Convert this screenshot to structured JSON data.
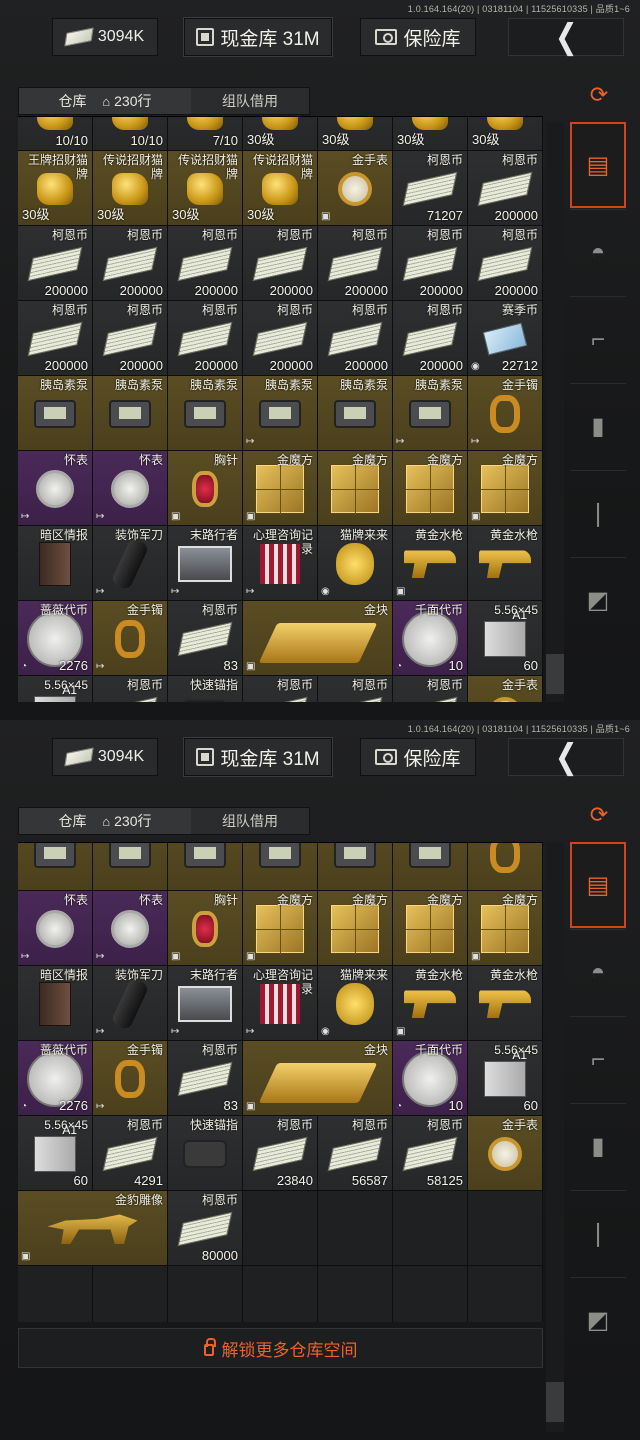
{
  "build": "1.0.164.164(20) | 03181104 | 11525610335 | 品质1~6",
  "topbar": {
    "cash": "3094K",
    "vault": "现金库 31M",
    "safe": "保险库"
  },
  "tabs": {
    "warehouse": "仓库",
    "rows": "230行",
    "team": "组队借用"
  },
  "unlock_label": "解锁更多仓库空间",
  "side_icons": [
    "refresh-icon",
    "warehouse-icon",
    "helmet-icon",
    "rifle-icon",
    "magazine-icon",
    "bullet-icon",
    "scope-icon"
  ],
  "panel1_rows": [
    [
      {
        "r": "gray",
        "ico": "i-tag",
        "c": "10/10"
      },
      {
        "r": "gray",
        "ico": "i-tag",
        "c": "10/10"
      },
      {
        "r": "gray",
        "ico": "i-tag",
        "c": "7/10"
      },
      {
        "r": "gray",
        "ico": "i-tag",
        "l": "30级"
      },
      {
        "r": "gray",
        "ico": "i-tag",
        "l": "30级"
      },
      {
        "r": "gray",
        "ico": "i-tag",
        "l": "30级"
      },
      {
        "r": "gray",
        "ico": "i-tag",
        "l": "30级"
      }
    ],
    [
      {
        "r": "gold",
        "n": "王牌招财猫牌",
        "ico": "i-tag",
        "l": "30级"
      },
      {
        "r": "gold",
        "n": "传说招财猫牌",
        "ico": "i-tag",
        "l": "30级"
      },
      {
        "r": "gold",
        "n": "传说招财猫牌",
        "ico": "i-tag",
        "l": "30级"
      },
      {
        "r": "gold",
        "n": "传说招财猫牌",
        "ico": "i-tag",
        "l": "30级"
      },
      {
        "r": "gold",
        "n": "金手表",
        "ico": "i-watch",
        "b": "box"
      },
      {
        "r": "gray",
        "n": "柯恩币",
        "ico": "i-cash",
        "c": "71207"
      },
      {
        "r": "gray",
        "n": "柯恩币",
        "ico": "i-cash",
        "c": "200000"
      }
    ],
    [
      {
        "r": "gray",
        "n": "柯恩币",
        "ico": "i-cash",
        "c": "200000"
      },
      {
        "r": "gray",
        "n": "柯恩币",
        "ico": "i-cash",
        "c": "200000"
      },
      {
        "r": "gray",
        "n": "柯恩币",
        "ico": "i-cash",
        "c": "200000"
      },
      {
        "r": "gray",
        "n": "柯恩币",
        "ico": "i-cash",
        "c": "200000"
      },
      {
        "r": "gray",
        "n": "柯恩币",
        "ico": "i-cash",
        "c": "200000"
      },
      {
        "r": "gray",
        "n": "柯恩币",
        "ico": "i-cash",
        "c": "200000"
      },
      {
        "r": "gray",
        "n": "柯恩币",
        "ico": "i-cash",
        "c": "200000"
      }
    ],
    [
      {
        "r": "gray",
        "n": "柯恩币",
        "ico": "i-cash",
        "c": "200000"
      },
      {
        "r": "gray",
        "n": "柯恩币",
        "ico": "i-cash",
        "c": "200000"
      },
      {
        "r": "gray",
        "n": "柯恩币",
        "ico": "i-cash",
        "c": "200000"
      },
      {
        "r": "gray",
        "n": "柯恩币",
        "ico": "i-cash",
        "c": "200000"
      },
      {
        "r": "gray",
        "n": "柯恩币",
        "ico": "i-cash",
        "c": "200000"
      },
      {
        "r": "gray",
        "n": "柯恩币",
        "ico": "i-cash",
        "c": "200000"
      },
      {
        "r": "gray",
        "n": "赛季币",
        "ico": "i-card",
        "c": "22712",
        "b": "season"
      }
    ],
    [
      {
        "r": "gold",
        "n": "胰岛素泵",
        "ico": "i-pager"
      },
      {
        "r": "gold",
        "n": "胰岛素泵",
        "ico": "i-pager"
      },
      {
        "r": "gold",
        "n": "胰岛素泵",
        "ico": "i-pager"
      },
      {
        "r": "gold",
        "n": "胰岛素泵",
        "ico": "i-pager",
        "b": "out"
      },
      {
        "r": "gold",
        "n": "胰岛素泵",
        "ico": "i-pager"
      },
      {
        "r": "gold",
        "n": "胰岛素泵",
        "ico": "i-pager",
        "b": "out"
      },
      {
        "r": "gold",
        "n": "金手镯",
        "ico": "i-ring",
        "b": "out"
      }
    ],
    [
      {
        "r": "purple",
        "n": "怀表",
        "ico": "i-pocket",
        "b": "out"
      },
      {
        "r": "purple",
        "n": "怀表",
        "ico": "i-pocket",
        "b": "out"
      },
      {
        "r": "gold",
        "n": "胸针",
        "ico": "i-brooch",
        "b": "box"
      },
      {
        "r": "gold",
        "n": "金魔方",
        "ico": "i-cube",
        "b": "box"
      },
      {
        "r": "gold",
        "n": "金魔方",
        "ico": "i-cube"
      },
      {
        "r": "gold",
        "n": "金魔方",
        "ico": "i-cube"
      },
      {
        "r": "gold",
        "n": "金魔方",
        "ico": "i-cube",
        "b": "box"
      }
    ],
    [
      {
        "r": "gray",
        "n": "暗区情报",
        "ico": "i-book"
      },
      {
        "r": "gray",
        "n": "装饰军刀",
        "ico": "i-knife",
        "b": "out"
      },
      {
        "r": "gray",
        "n": "末路行者",
        "ico": "i-photo",
        "b": "out"
      },
      {
        "r": "gray",
        "n": "心理咨询记录",
        "ico": "i-pack",
        "b": "out"
      },
      {
        "r": "gray",
        "n": "猫牌来来",
        "ico": "i-lucky",
        "b": "season"
      },
      {
        "r": "gray",
        "n": "黄金水枪",
        "ico": "i-pistol",
        "b": "box"
      },
      {
        "r": "gray",
        "n": "黄金水枪",
        "ico": "i-pistol"
      }
    ],
    [
      {
        "r": "purple",
        "n": "蔷薇代币",
        "ico": "i-coin",
        "c": "2276",
        "b": "clock"
      },
      {
        "r": "gold",
        "n": "金手镯",
        "ico": "i-ring",
        "b": "out"
      },
      {
        "r": "gray",
        "n": "柯恩币",
        "ico": "i-cash",
        "c": "83"
      },
      {
        "r": "gold",
        "n": "金块",
        "ico": "i-bars",
        "span": 2,
        "b": "box"
      },
      {
        "r": "purple",
        "n": "千面代币",
        "ico": "i-coin",
        "c": "10",
        "b": "clock"
      },
      {
        "r": "gray",
        "n": "5.56×45",
        "ico": "i-ammo",
        "c": "60"
      }
    ],
    [
      {
        "r": "gray",
        "n": "5.56×45",
        "ico": "i-ammo"
      },
      {
        "r": "gray",
        "n": "柯恩币",
        "ico": "i-cash"
      },
      {
        "r": "gray",
        "n": "快速锚指",
        "ico": "i-scope"
      },
      {
        "r": "gray",
        "n": "柯恩币",
        "ico": "i-cash"
      },
      {
        "r": "gray",
        "n": "柯恩币",
        "ico": "i-cash"
      },
      {
        "r": "gray",
        "n": "柯恩币",
        "ico": "i-cash"
      },
      {
        "r": "gold",
        "n": "金手表",
        "ico": "i-watch"
      }
    ]
  ],
  "panel2_rows": [
    [
      {
        "r": "gold",
        "ico": "i-pager"
      },
      {
        "r": "gold",
        "ico": "i-pager"
      },
      {
        "r": "gold",
        "ico": "i-pager"
      },
      {
        "r": "gold",
        "ico": "i-pager"
      },
      {
        "r": "gold",
        "ico": "i-pager"
      },
      {
        "r": "gold",
        "ico": "i-pager"
      },
      {
        "r": "gold",
        "ico": "i-ring"
      }
    ],
    [
      {
        "r": "purple",
        "n": "怀表",
        "ico": "i-pocket",
        "b": "out"
      },
      {
        "r": "purple",
        "n": "怀表",
        "ico": "i-pocket",
        "b": "out"
      },
      {
        "r": "gold",
        "n": "胸针",
        "ico": "i-brooch",
        "b": "box"
      },
      {
        "r": "gold",
        "n": "金魔方",
        "ico": "i-cube",
        "b": "box"
      },
      {
        "r": "gold",
        "n": "金魔方",
        "ico": "i-cube"
      },
      {
        "r": "gold",
        "n": "金魔方",
        "ico": "i-cube"
      },
      {
        "r": "gold",
        "n": "金魔方",
        "ico": "i-cube",
        "b": "box"
      }
    ],
    [
      {
        "r": "gray",
        "n": "暗区情报",
        "ico": "i-book"
      },
      {
        "r": "gray",
        "n": "装饰军刀",
        "ico": "i-knife",
        "b": "out"
      },
      {
        "r": "gray",
        "n": "末路行者",
        "ico": "i-photo",
        "b": "out"
      },
      {
        "r": "gray",
        "n": "心理咨询记录",
        "ico": "i-pack",
        "b": "out"
      },
      {
        "r": "gray",
        "n": "猫牌来来",
        "ico": "i-lucky",
        "b": "season"
      },
      {
        "r": "gray",
        "n": "黄金水枪",
        "ico": "i-pistol",
        "b": "box"
      },
      {
        "r": "gray",
        "n": "黄金水枪",
        "ico": "i-pistol"
      }
    ],
    [
      {
        "r": "purple",
        "n": "蔷薇代币",
        "ico": "i-coin",
        "c": "2276",
        "b": "clock"
      },
      {
        "r": "gold",
        "n": "金手镯",
        "ico": "i-ring",
        "b": "out"
      },
      {
        "r": "gray",
        "n": "柯恩币",
        "ico": "i-cash",
        "c": "83"
      },
      {
        "r": "gold",
        "n": "金块",
        "ico": "i-bars",
        "span": 2,
        "b": "box"
      },
      {
        "r": "purple",
        "n": "千面代币",
        "ico": "i-coin",
        "c": "10",
        "b": "clock"
      },
      {
        "r": "gray",
        "n": "5.56×45",
        "ico": "i-ammo",
        "c": "60"
      }
    ],
    [
      {
        "r": "gray",
        "n": "5.56×45",
        "ico": "i-ammo",
        "c": "60"
      },
      {
        "r": "gray",
        "n": "柯恩币",
        "ico": "i-cash",
        "c": "4291"
      },
      {
        "r": "gray",
        "n": "快速锚指",
        "ico": "i-scope"
      },
      {
        "r": "gray",
        "n": "柯恩币",
        "ico": "i-cash",
        "c": "23840"
      },
      {
        "r": "gray",
        "n": "柯恩币",
        "ico": "i-cash",
        "c": "56587"
      },
      {
        "r": "gray",
        "n": "柯恩币",
        "ico": "i-cash",
        "c": "58125"
      },
      {
        "r": "gold",
        "n": "金手表",
        "ico": "i-watch"
      }
    ],
    [
      {
        "r": "gold",
        "n": "金豹雕像",
        "ico": "i-leopard",
        "span": 2,
        "b": "box"
      },
      {
        "r": "gray",
        "n": "柯恩币",
        "ico": "i-cash",
        "c": "80000"
      },
      {
        "r": "empty"
      },
      {
        "r": "empty"
      },
      {
        "r": "empty"
      },
      {
        "r": "empty"
      }
    ],
    [
      {
        "r": "empty"
      },
      {
        "r": "empty"
      },
      {
        "r": "empty"
      },
      {
        "r": "empty"
      },
      {
        "r": "empty"
      },
      {
        "r": "empty"
      },
      {
        "r": "empty"
      }
    ]
  ]
}
